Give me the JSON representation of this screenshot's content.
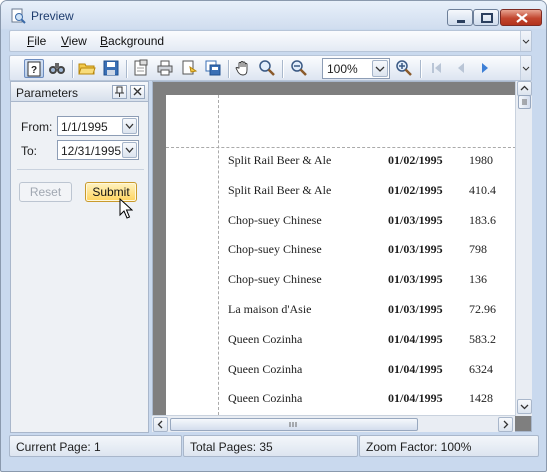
{
  "window": {
    "title": "Preview"
  },
  "menu": [
    {
      "label": "File",
      "u": "F",
      "rest": "ile"
    },
    {
      "label": "View",
      "u": "V",
      "rest": "iew"
    },
    {
      "label": "Background",
      "u": "B",
      "rest": "ackground"
    }
  ],
  "toolbar": {
    "zoom_value": "100%"
  },
  "parameters": {
    "title": "Parameters",
    "from_label": "From:",
    "from_value": "1/1/1995",
    "to_label": "To:",
    "to_value": "12/31/1995",
    "reset_label": "Reset",
    "submit_label": "Submit"
  },
  "report": {
    "rows": [
      {
        "name": "Split Rail Beer & Ale",
        "date": "01/02/1995",
        "amount": "1980"
      },
      {
        "name": "Split Rail Beer & Ale",
        "date": "01/02/1995",
        "amount": "410.4"
      },
      {
        "name": "Chop-suey Chinese",
        "date": "01/03/1995",
        "amount": "183.6"
      },
      {
        "name": "Chop-suey Chinese",
        "date": "01/03/1995",
        "amount": "798"
      },
      {
        "name": "Chop-suey Chinese",
        "date": "01/03/1995",
        "amount": "136"
      },
      {
        "name": "La maison d'Asie",
        "date": "01/03/1995",
        "amount": "72.96"
      },
      {
        "name": "Queen Cozinha",
        "date": "01/04/1995",
        "amount": "583.2"
      },
      {
        "name": "Queen Cozinha",
        "date": "01/04/1995",
        "amount": "6324"
      },
      {
        "name": "Queen Cozinha",
        "date": "01/04/1995",
        "amount": "1428"
      }
    ]
  },
  "status": {
    "current_page": "Current Page: 1",
    "total_pages": "Total Pages: 35",
    "zoom_factor": "Zoom Factor: 100%"
  },
  "icons": [
    "preview-app-icon",
    "parameters-toggle-icon",
    "search-binoculars-icon",
    "open-folder-icon",
    "save-disk-icon",
    "page-setup-icon",
    "print-icon",
    "quick-print-icon",
    "export-icon",
    "hand-tool-icon",
    "magnifier-icon",
    "zoom-out-icon",
    "zoom-in-icon",
    "first-page-icon",
    "previous-page-icon",
    "next-page-icon"
  ]
}
